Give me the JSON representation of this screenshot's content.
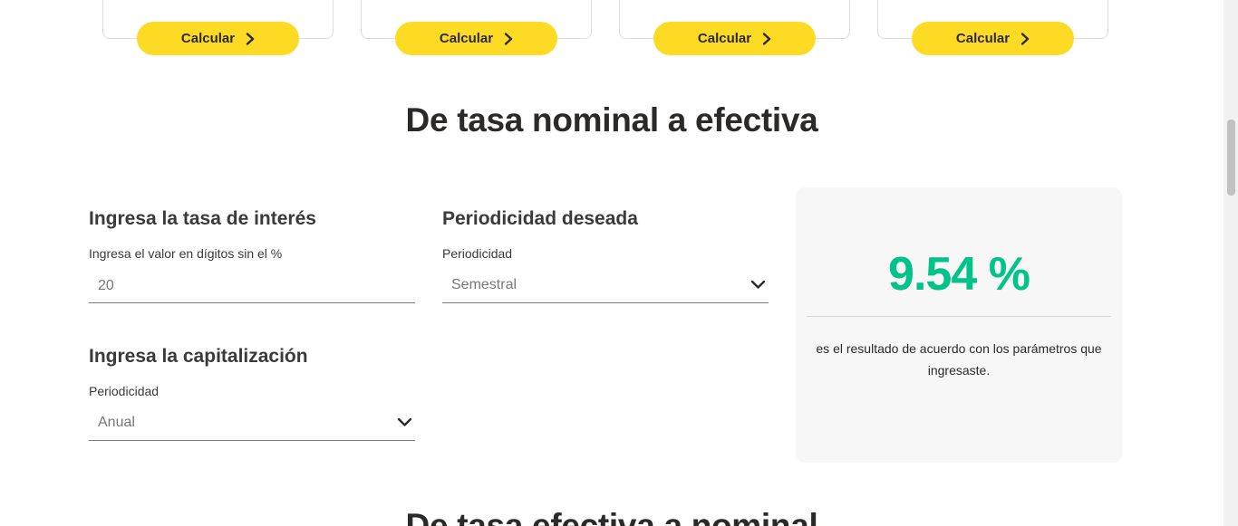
{
  "cards": [
    {
      "button_label": "Calcular"
    },
    {
      "button_label": "Calcular"
    },
    {
      "button_label": "Calcular"
    },
    {
      "button_label": "Calcular"
    }
  ],
  "section_title": "De tasa nominal a efectiva",
  "interest": {
    "title": "Ingresa la tasa de interés",
    "label": "Ingresa el valor en dígitos sin el %",
    "value": "20"
  },
  "desired_period": {
    "title": "Periodicidad deseada",
    "label": "Periodicidad",
    "selected": "Semestral"
  },
  "capitalization": {
    "title": "Ingresa la capitalización",
    "label": "Periodicidad",
    "selected": "Anual"
  },
  "result": {
    "value": "9.54 %",
    "description": "es el resultado de acuerdo con los parámetros que ingresaste."
  },
  "next_section_title": "De tasa efectiva a nominal",
  "colors": {
    "accent_yellow": "#fdda24",
    "result_green": "#00c389",
    "text_dark": "#2c2a29"
  }
}
